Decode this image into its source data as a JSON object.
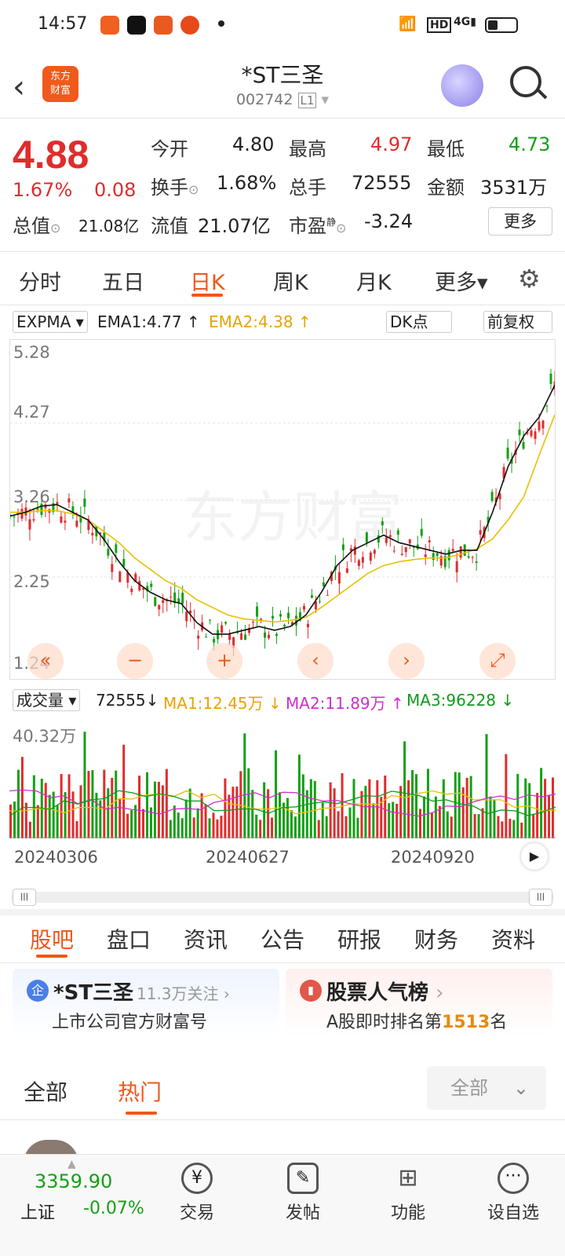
{
  "status": {
    "time": "14:57"
  },
  "header": {
    "title": "*ST三圣",
    "code": "002742",
    "level": "L1",
    "logo_line1": "东方",
    "logo_line2": "财富"
  },
  "quote": {
    "price": "4.88",
    "change_pct": "1.67%",
    "change": "0.08",
    "open_label": "今开",
    "open": "4.80",
    "high_label": "最高",
    "high": "4.97",
    "low_label": "最低",
    "low": "4.73",
    "turnover_label": "换手",
    "turnover": "1.68%",
    "volume_label": "总手",
    "volume": "72555",
    "amount_label": "金额",
    "amount": "3531万",
    "mktcap_label": "总值",
    "mktcap": "21.08亿",
    "float_label": "流值",
    "float": "21.07亿",
    "pe_label": "市盈",
    "pe_sup": "静",
    "pe": "-3.24",
    "more": "更多"
  },
  "ktabs": [
    "分时",
    "五日",
    "日K",
    "周K",
    "月K",
    "更多▾"
  ],
  "indicator": {
    "name": "EXPMA",
    "ema1": "EMA1:4.77",
    "ema2": "EMA2:4.38",
    "dk": "DK点",
    "adj": "前复权"
  },
  "kchart": {
    "ylabels": [
      "5.28",
      "4.27",
      "3.26",
      "2.25",
      "1.24"
    ],
    "watermark": "东方财富"
  },
  "volume": {
    "name": "成交量",
    "vol": "72555",
    "ma1": "MA1:12.45万",
    "ma2": "MA2:11.89万",
    "ma3": "MA3:96228",
    "max": "40.32万"
  },
  "dates": [
    "20240306",
    "20240627",
    "20240920"
  ],
  "sections": [
    "股吧",
    "盘口",
    "资讯",
    "公告",
    "研报",
    "财务",
    "资料"
  ],
  "card1": {
    "title": "*ST三圣",
    "follow": "11.3万关注",
    "sub": "上市公司官方财富号"
  },
  "card2": {
    "title": "股票人气榜",
    "sub_pre": "A股即时排名第",
    "rank": "1513",
    "sub_post": "名"
  },
  "filter": {
    "all": "全部",
    "hot": "热门",
    "select": "全部"
  },
  "bottom": {
    "index_value": "3359.90",
    "index_name": "上证",
    "index_change": "-0.07%",
    "nav": [
      "交易",
      "发帖",
      "功能",
      "设自选"
    ]
  },
  "chart_data": {
    "type": "candlestick",
    "ylim": [
      1.24,
      5.28
    ],
    "series": [
      {
        "name": "EMA1",
        "values": [
          3.05,
          3.1,
          3.18,
          3.2,
          3.1,
          3.0,
          2.75,
          2.45,
          2.2,
          2.05,
          1.95,
          1.9,
          1.65,
          1.5,
          1.5,
          1.55,
          1.6,
          1.55,
          1.6,
          1.75,
          2.05,
          2.4,
          2.6,
          2.7,
          2.8,
          2.7,
          2.65,
          2.6,
          2.55,
          2.6,
          2.6,
          3.1,
          3.7,
          4.1,
          4.35,
          4.77
        ]
      },
      {
        "name": "EMA2",
        "values": [
          3.1,
          3.1,
          3.12,
          3.12,
          3.08,
          3.0,
          2.85,
          2.7,
          2.5,
          2.35,
          2.2,
          2.1,
          1.95,
          1.85,
          1.75,
          1.7,
          1.68,
          1.66,
          1.68,
          1.72,
          1.85,
          2.0,
          2.15,
          2.3,
          2.4,
          2.45,
          2.48,
          2.5,
          2.5,
          2.55,
          2.62,
          2.75,
          3.0,
          3.3,
          3.85,
          4.38
        ]
      }
    ]
  }
}
